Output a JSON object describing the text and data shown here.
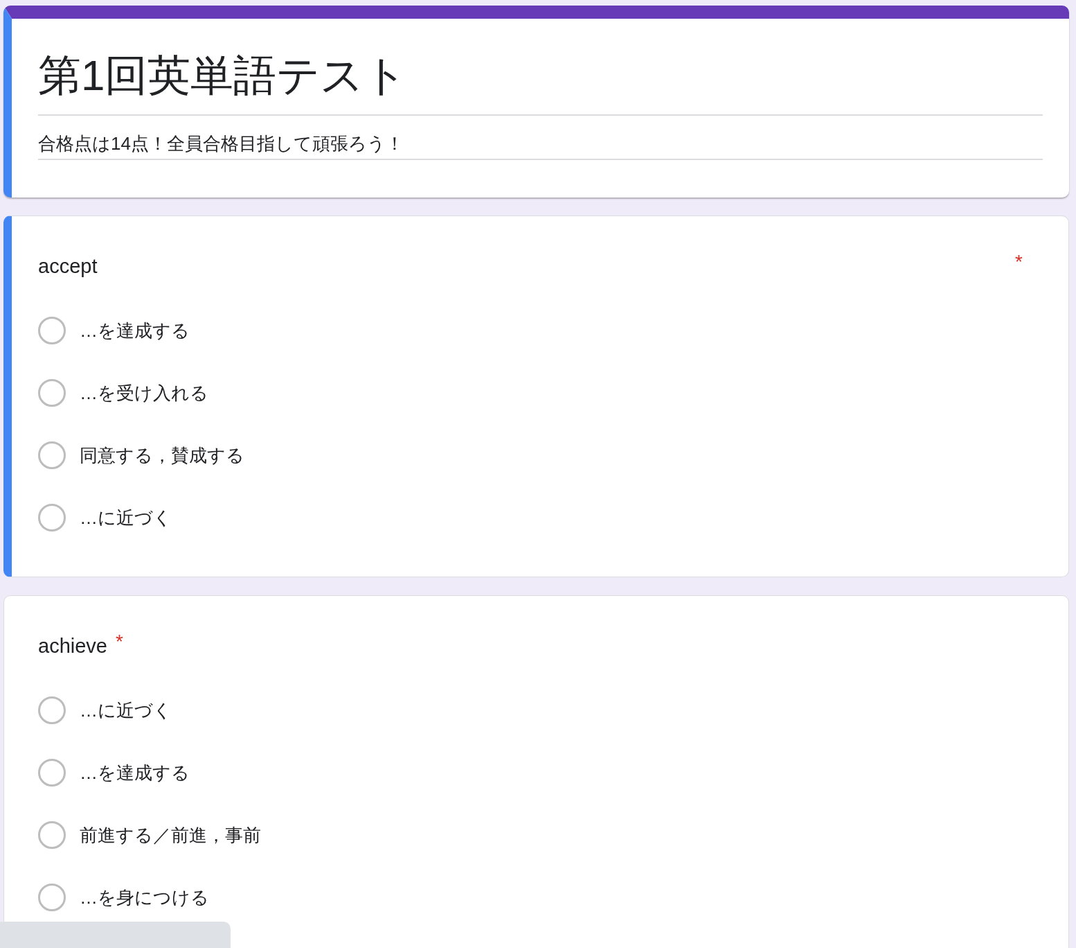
{
  "form": {
    "title": "第1回英単語テスト",
    "description": "合格点は14点！全員合格目指して頑張ろう！"
  },
  "questions": [
    {
      "title": "accept",
      "kind": "spread",
      "required_mark": "*",
      "selected": true,
      "options": [
        {
          "label": "…を達成する",
          "selected": false
        },
        {
          "label": "…を受け入れる",
          "selected": false
        },
        {
          "label": "同意する，賛成する",
          "selected": false
        },
        {
          "label": "…に近づく",
          "selected": false
        }
      ]
    },
    {
      "title": "achieve",
      "kind": "compact",
      "required_mark": "*",
      "selected": false,
      "options": [
        {
          "label": "…に近づく",
          "selected": false
        },
        {
          "label": "…を達成する",
          "selected": false
        },
        {
          "label": "前進する／前進，事前",
          "selected": false
        },
        {
          "label": "…を身につける",
          "selected": false
        }
      ]
    }
  ]
}
